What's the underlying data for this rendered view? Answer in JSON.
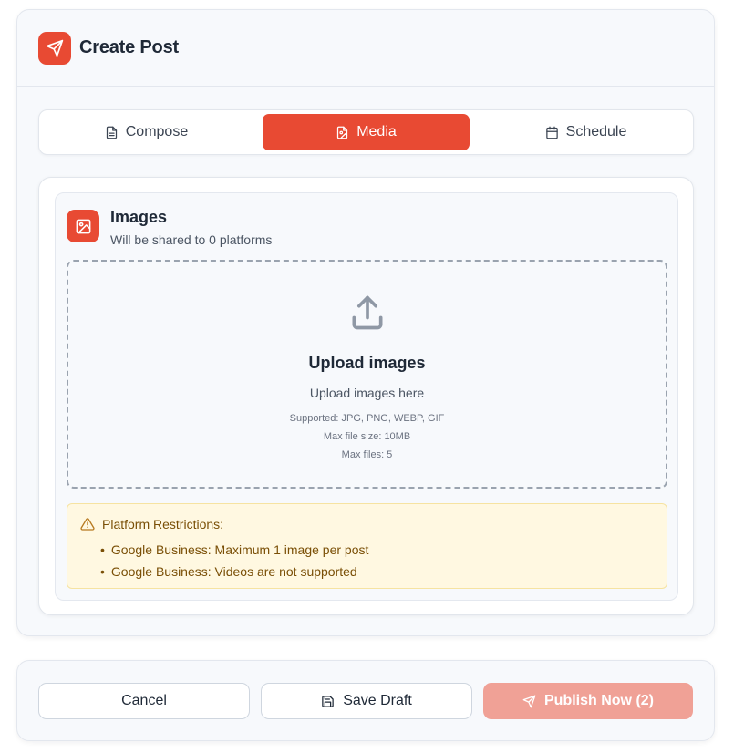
{
  "header": {
    "title": "Create Post",
    "icon": "send-icon"
  },
  "tabs": [
    {
      "label": "Compose",
      "icon": "document-icon",
      "active": false
    },
    {
      "label": "Media",
      "icon": "image-file-icon",
      "active": true
    },
    {
      "label": "Schedule",
      "icon": "calendar-icon",
      "active": false
    }
  ],
  "media": {
    "title": "Images",
    "subtitle": "Will be shared to 0 platforms",
    "icon": "image-icon",
    "dropzone": {
      "title": "Upload images",
      "hint": "Upload images here",
      "supported": "Supported: JPG, PNG, WEBP, GIF",
      "max_size": "Max file size: 10MB",
      "max_files": "Max files: 5",
      "icon": "upload-icon"
    },
    "restrictions": {
      "heading": "Platform Restrictions:",
      "items": [
        "Google Business: Maximum 1 image per post",
        "Google Business: Videos are not supported"
      ]
    }
  },
  "footer": {
    "cancel_label": "Cancel",
    "save_draft_label": "Save Draft",
    "publish_label": "Publish Now (2)"
  },
  "colors": {
    "accent": "#e84a33",
    "accent_disabled": "#f0a196",
    "warning_bg": "#fff8e1",
    "warning_text": "#7a4f06"
  }
}
